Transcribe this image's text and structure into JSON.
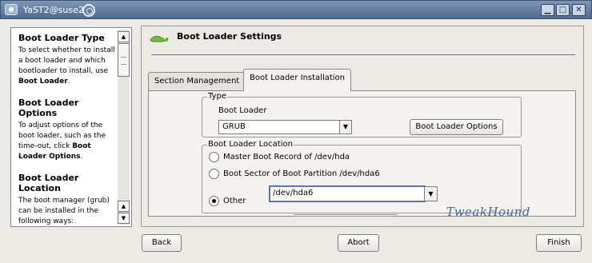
{
  "window": {
    "title": "YaST2@suse2",
    "minimize_glyph": "▁",
    "maximize_glyph": "□",
    "close_glyph": "✕",
    "icons": [
      "app-icon",
      "swirl-icon"
    ]
  },
  "help": {
    "scroll_up": "▲",
    "scroll_down": "▼",
    "sections": [
      {
        "heading": "Boot Loader Type",
        "text": "To select whether to install a boot loader and which bootloader to install, use ",
        "strong": "Boot Loader",
        "tail": "."
      },
      {
        "heading": "Boot Loader Options",
        "text": "To adjust options of the boot loader, such as the time-out, click ",
        "strong": "Boot Loader Options",
        "tail": "."
      },
      {
        "heading": "Boot Loader Location",
        "text": "The boot manager (grub) can be installed in the following ways:",
        "strong": "",
        "tail": ""
      }
    ]
  },
  "page": {
    "title": "Boot Loader Settings",
    "icon": "gecko-icon",
    "tabs": {
      "section_management": "Section Management",
      "boot_loader_installation": "Boot Loader Installation"
    },
    "type_group": {
      "legend": "Type",
      "boot_loader_label": "Boot Loader",
      "boot_loader_value": "GRUB",
      "options_button": "Boot Loader Options"
    },
    "location_group": {
      "legend": "Boot Loader Location",
      "mbr": "Master Boot Record of /dev/hda",
      "boot_sector": "Boot Sector of Boot Partition /dev/hda6",
      "other": "Other",
      "other_value": "/dev/hda6",
      "selected": "other"
    },
    "watermark": "TweakHound"
  },
  "footer": {
    "back": "Back",
    "abort": "Abort",
    "finish": "Finish"
  },
  "colors": {
    "titlebar": "#5f7aa0",
    "background": "#eceae4",
    "watermark": "#3f6aa6"
  }
}
